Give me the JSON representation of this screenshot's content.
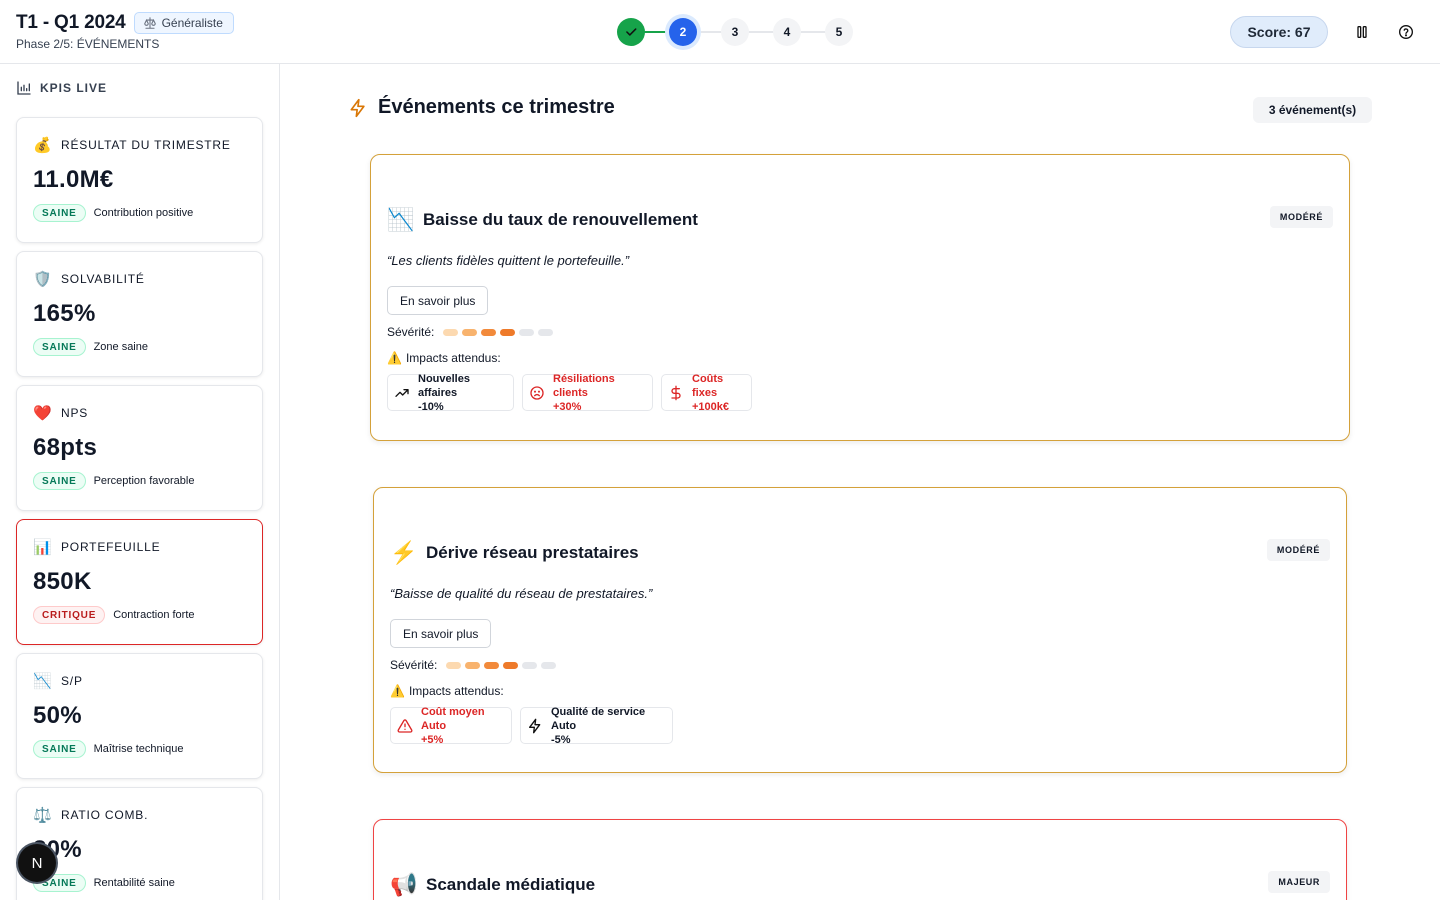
{
  "header": {
    "title": "T1 - Q1 2024",
    "profile": "Généraliste",
    "phase": "Phase 2/5: ÉVÉNEMENTS",
    "steps": [
      "1",
      "2",
      "3",
      "4",
      "5"
    ],
    "score": "Score: 67"
  },
  "sidebar": {
    "heading": "KPIS LIVE",
    "kpis": [
      {
        "emoji": "💰",
        "label": "RÉSULTAT DU TRIMESTRE",
        "value": "11.0M€",
        "status": "SAINE",
        "note": "Contribution positive"
      },
      {
        "emoji": "🛡️",
        "label": "SOLVABILITÉ",
        "value": "165%",
        "status": "SAINE",
        "note": "Zone saine"
      },
      {
        "emoji": "❤️",
        "label": "NPS",
        "value": "68pts",
        "status": "SAINE",
        "note": "Perception favorable"
      },
      {
        "emoji": "📊",
        "label": "PORTEFEUILLE",
        "value": "850K",
        "status": "CRITIQUE",
        "note": "Contraction forte"
      },
      {
        "emoji": "📉",
        "label": "S/P",
        "value": "50%",
        "status": "SAINE",
        "note": "Maîtrise technique"
      },
      {
        "emoji": "⚖️",
        "label": "RATIO COMB.",
        "value": "80%",
        "status": "SAINE",
        "note": "Rentabilité saine"
      }
    ],
    "avatar": "N"
  },
  "main": {
    "title": "Événements ce trimestre",
    "count": "3 événement(s)",
    "severity_label": "Sévérité:",
    "impacts_label": "Impacts attendus:",
    "more_label": "En savoir plus",
    "severity_colors": [
      "#fcd9b0",
      "#f8b36e",
      "#f28a3b",
      "#ee7a2a",
      "#e5e7eb",
      "#e5e7eb"
    ],
    "events": [
      {
        "emoji": "📉",
        "title": "Baisse du taux de renouvellement",
        "badge": "MODÉRÉ",
        "quote": "“Les clients fidèles quittent le portefeuille.”",
        "severity": 4,
        "impacts": [
          {
            "icon": "trend-up-icon",
            "label": "Nouvelles affaires",
            "value": "-10%",
            "negative": false
          },
          {
            "icon": "frown-icon",
            "label": "Résiliations clients",
            "value": "+30%",
            "negative": true
          },
          {
            "icon": "dollar-icon",
            "label": "Coûts fixes",
            "value": "+100k€",
            "negative": true
          }
        ]
      },
      {
        "emoji": "⚡",
        "title": "Dérive réseau prestataires",
        "badge": "MODÉRÉ",
        "quote": "“Baisse de qualité du réseau de prestataires.”",
        "severity": 4,
        "impacts": [
          {
            "icon": "alert-triangle-icon",
            "label": "Coût moyen Auto",
            "value": "+5%",
            "negative": true
          },
          {
            "icon": "zap-icon",
            "label": "Qualité de service Auto",
            "value": "-5%",
            "negative": false
          }
        ]
      },
      {
        "emoji": "📢",
        "title": "Scandale médiatique",
        "badge": "MAJEUR"
      }
    ]
  }
}
